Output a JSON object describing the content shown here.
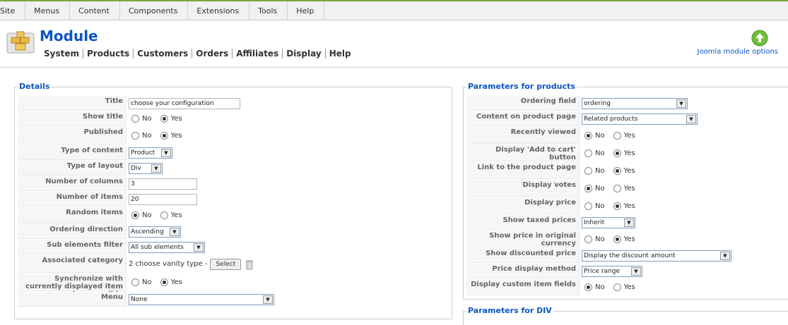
{
  "menu": [
    "Site",
    "Menus",
    "Content",
    "Components",
    "Extensions",
    "Tools",
    "Help"
  ],
  "header": {
    "title": "Module",
    "subnav": [
      "System",
      "Products",
      "Customers",
      "Orders",
      "Affiliates",
      "Display",
      "Help"
    ],
    "options_label": "Joomla module options"
  },
  "details": {
    "legend": "Details",
    "title_label": "Title",
    "title_value": "choose your configuration",
    "show_title_label": "Show title",
    "published_label": "Published",
    "type_content_label": "Type of content",
    "type_content_value": "Product",
    "type_layout_label": "Type of layout",
    "type_layout_value": "Div",
    "num_columns_label": "Number of columns",
    "num_columns_value": "3",
    "num_items_label": "Number of items",
    "num_items_value": "20",
    "random_items_label": "Random items",
    "ordering_dir_label": "Ordering direction",
    "ordering_dir_value": "Ascending",
    "sub_filter_label": "Sub elements filter",
    "sub_filter_value": "All sub elements",
    "assoc_cat_label": "Associated category",
    "assoc_cat_value": "2 choose vanity type -",
    "select_button": "Select",
    "sync_label": "Synchronize with currently displayed item when possible",
    "menu_label": "Menu",
    "menu_value": "None"
  },
  "radio": {
    "no": "No",
    "yes": "Yes"
  },
  "products": {
    "legend": "Parameters for products",
    "ordering_field_label": "Ordering field",
    "ordering_field_value": "ordering",
    "content_page_label": "Content on product page",
    "content_page_value": "Related products",
    "recently_viewed_label": "Recently viewed",
    "add_cart_label": "Display 'Add to cart' button",
    "link_product_label": "Link to the product page",
    "votes_label": "Display votes",
    "price_label": "Display price",
    "taxed_label": "Show taxed prices",
    "taxed_value": "Inherit",
    "orig_currency_label": "Show price in original currency",
    "discounted_label": "Show discounted price",
    "discounted_value": "Display the discount amount",
    "price_method_label": "Price display method",
    "price_method_value": "Price range",
    "custom_fields_label": "Display custom item fields"
  },
  "div_params": {
    "legend": "Parameters for DIV"
  }
}
